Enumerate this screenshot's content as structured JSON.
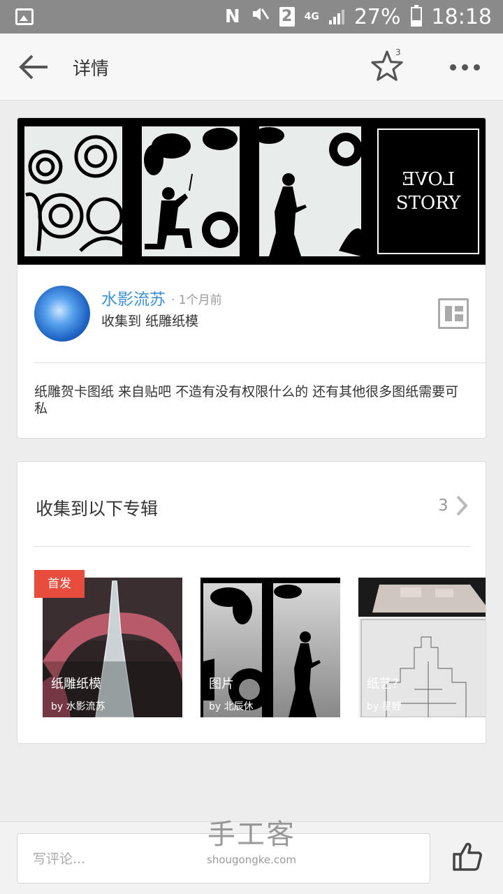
{
  "status_bar": {
    "n_icon": "N",
    "mute_icon": "mute-icon",
    "sim": "2",
    "network": "4G",
    "battery": "27%",
    "time": "18:18"
  },
  "header": {
    "title": "详情",
    "star_count": "3"
  },
  "post": {
    "banner_text_line1": "LOVE",
    "banner_text_line2": "STORY",
    "author": "水影流苏",
    "time": "· 1个月前",
    "collected_to": "收集到 纸雕纸模",
    "description": "纸雕贺卡图纸 来自贴吧 不造有没有权限什么的 还有其他很多图纸需要可私"
  },
  "albums": {
    "title": "收集到以下专辑",
    "count": "3",
    "badge": "首发",
    "items": [
      {
        "name": "纸雕纸模",
        "by": "by 水影流苏"
      },
      {
        "name": "图片",
        "by": "by 北辰休"
      },
      {
        "name": "纸艺？",
        "by": "by 星鲤"
      }
    ]
  },
  "bottom": {
    "comment_placeholder": "写评论..."
  },
  "watermark": {
    "cn": "手工客",
    "en": "shougongke.com"
  },
  "colors": {
    "link_blue": "#3d8fd6",
    "badge_red": "#e84c3d",
    "status_bar": "#8a8a8a"
  }
}
